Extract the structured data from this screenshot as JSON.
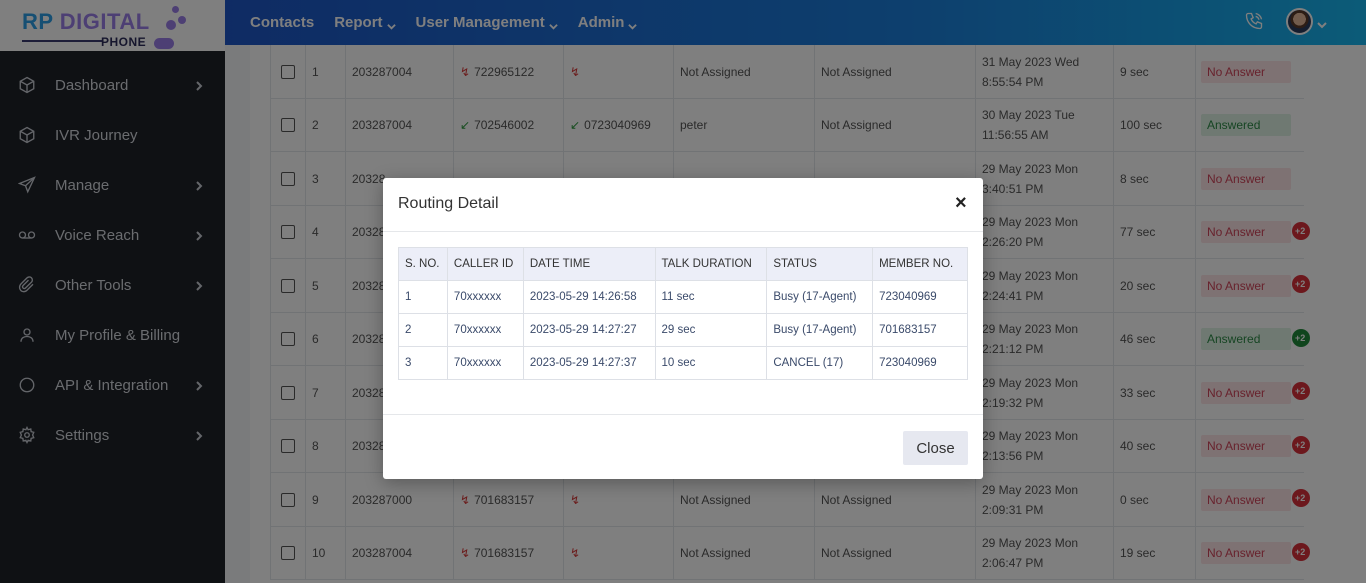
{
  "logo": {
    "main_rp": "RP",
    "main_digital": "DIGITAL",
    "sub": "PHONE"
  },
  "sidebar": {
    "items": [
      {
        "label": "Dashboard",
        "icon": "cube-icon",
        "chevron": true
      },
      {
        "label": "IVR Journey",
        "icon": "cube-icon",
        "chevron": false
      },
      {
        "label": "Manage",
        "icon": "send-icon",
        "chevron": true
      },
      {
        "label": "Voice Reach",
        "icon": "voicemail-icon",
        "chevron": true
      },
      {
        "label": "Other Tools",
        "icon": "paperclip-icon",
        "chevron": true
      },
      {
        "label": "My Profile & Billing",
        "icon": "user-icon",
        "chevron": false
      },
      {
        "label": "API & Integration",
        "icon": "circle-icon",
        "chevron": true
      },
      {
        "label": "Settings",
        "icon": "gear-icon",
        "chevron": true
      }
    ]
  },
  "topbar": {
    "items": [
      {
        "label": "Contacts",
        "caret": false
      },
      {
        "label": "Report",
        "caret": true
      },
      {
        "label": "User Management",
        "caret": true
      },
      {
        "label": "Admin",
        "caret": true
      }
    ]
  },
  "table": {
    "rows": [
      {
        "no": "1",
        "num": "203287004",
        "caller": "722965122",
        "caller_dir": "missed",
        "dest": "",
        "dest_dir": "missed",
        "agent": "Not Assigned",
        "group": "Not Assigned",
        "date1": "31 May 2023 Wed",
        "date2": "8:55:54 PM",
        "duration": "9 sec",
        "status": "No Answer",
        "badge": ""
      },
      {
        "no": "2",
        "num": "203287004",
        "caller": "702546002",
        "caller_dir": "incoming",
        "dest": "0723040969",
        "dest_dir": "incoming",
        "agent": "peter",
        "group": "Not Assigned",
        "date1": "30 May 2023 Tue",
        "date2": "11:56:55 AM",
        "duration": "100 sec",
        "status": "Answered",
        "badge": ""
      },
      {
        "no": "3",
        "num": "20328",
        "caller": "",
        "caller_dir": "",
        "dest": "",
        "dest_dir": "",
        "agent": "",
        "group": "",
        "date1": "29 May 2023 Mon",
        "date2": "3:40:51 PM",
        "duration": "8 sec",
        "status": "No Answer",
        "badge": ""
      },
      {
        "no": "4",
        "num": "20328",
        "caller": "",
        "caller_dir": "",
        "dest": "",
        "dest_dir": "",
        "agent": "",
        "group": "",
        "date1": "29 May 2023 Mon",
        "date2": "2:26:20 PM",
        "duration": "77 sec",
        "status": "No Answer",
        "badge": "+2"
      },
      {
        "no": "5",
        "num": "20328",
        "caller": "",
        "caller_dir": "",
        "dest": "",
        "dest_dir": "",
        "agent": "",
        "group": "",
        "date1": "29 May 2023 Mon",
        "date2": "2:24:41 PM",
        "duration": "20 sec",
        "status": "No Answer",
        "badge": "+2"
      },
      {
        "no": "6",
        "num": "20328",
        "caller": "",
        "caller_dir": "",
        "dest": "",
        "dest_dir": "",
        "agent": "",
        "group": "",
        "date1": "29 May 2023 Mon",
        "date2": "2:21:12 PM",
        "duration": "46 sec",
        "status": "Answered",
        "badge": "+2"
      },
      {
        "no": "7",
        "num": "20328",
        "caller": "",
        "caller_dir": "",
        "dest": "",
        "dest_dir": "",
        "agent": "",
        "group": "",
        "date1": "29 May 2023 Mon",
        "date2": "2:19:32 PM",
        "duration": "33 sec",
        "status": "No Answer",
        "badge": "+2"
      },
      {
        "no": "8",
        "num": "20328",
        "caller": "",
        "caller_dir": "",
        "dest": "",
        "dest_dir": "",
        "agent": "",
        "group": "",
        "date1": "29 May 2023 Mon",
        "date2": "2:13:56 PM",
        "duration": "40 sec",
        "status": "No Answer",
        "badge": "+2"
      },
      {
        "no": "9",
        "num": "203287000",
        "caller": "701683157",
        "caller_dir": "missed",
        "dest": "",
        "dest_dir": "missed",
        "agent": "Not Assigned",
        "group": "Not Assigned",
        "date1": "29 May 2023 Mon",
        "date2": "2:09:31 PM",
        "duration": "0 sec",
        "status": "No Answer",
        "badge": "+2"
      },
      {
        "no": "10",
        "num": "203287004",
        "caller": "701683157",
        "caller_dir": "missed",
        "dest": "",
        "dest_dir": "missed",
        "agent": "Not Assigned",
        "group": "Not Assigned",
        "date1": "29 May 2023 Mon",
        "date2": "2:06:47 PM",
        "duration": "19 sec",
        "status": "No Answer",
        "badge": "+2"
      }
    ]
  },
  "modal": {
    "title": "Routing Detail",
    "close_symbol": "×",
    "close_button": "Close",
    "headers": [
      "S. NO.",
      "CALLER ID",
      "DATE TIME",
      "TALK DURATION",
      "STATUS",
      "MEMBER NO."
    ],
    "rows": [
      [
        "1",
        "70xxxxxx",
        "2023-05-29 14:26:58",
        "11 sec",
        "Busy (17-Agent)",
        "723040969"
      ],
      [
        "2",
        "70xxxxxx",
        "2023-05-29 14:27:27",
        "29 sec",
        "Busy (17-Agent)",
        "701683157"
      ],
      [
        "3",
        "70xxxxxx",
        "2023-05-29 14:27:37",
        "10 sec",
        "CANCEL (17)",
        "723040969"
      ]
    ]
  },
  "colors": {
    "sidebar_bg": "#1f2229",
    "topbar_start": "#1e57c8",
    "topbar_end": "#19b7f0",
    "no_answer": "#d0455a",
    "answered": "#2c8a47"
  }
}
